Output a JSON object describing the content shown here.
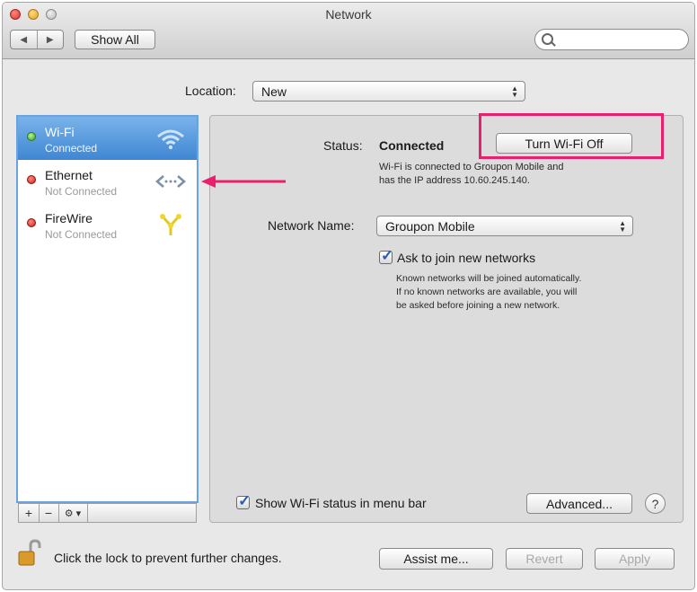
{
  "window": {
    "title": "Network"
  },
  "toolbar": {
    "back": "◀",
    "forward": "▶",
    "show_all": "Show All",
    "search_placeholder": ""
  },
  "location": {
    "label": "Location:",
    "value": "New"
  },
  "services": [
    {
      "name": "Wi-Fi",
      "status": "Connected",
      "dot": "#3a9d1d",
      "icon": "wifi-icon",
      "selected": true
    },
    {
      "name": "Ethernet",
      "status": "Not Connected",
      "dot": "#c81e16",
      "icon": "ethernet-arrows-icon",
      "selected": false
    },
    {
      "name": "FireWire",
      "status": "Not Connected",
      "dot": "#c81e16",
      "icon": "firewire-icon",
      "selected": false
    }
  ],
  "sidebar_tools": {
    "add": "+",
    "remove": "−",
    "gear": "⚙ ▾"
  },
  "detail": {
    "status_label": "Status:",
    "status_value": "Connected",
    "turn_off_button": "Turn Wi-Fi Off",
    "status_desc_1": "Wi-Fi is connected to Groupon Mobile and",
    "status_desc_2": "has the IP address 10.60.245.140.",
    "network_name_label": "Network Name:",
    "network_name_value": "Groupon Mobile",
    "ask_join_label": "Ask to join new networks",
    "ask_join_checked": true,
    "ask_join_desc_1": "Known networks will be joined automatically.",
    "ask_join_desc_2": "If no known networks are available, you will",
    "ask_join_desc_3": "be asked before joining a new network.",
    "show_status_label": "Show Wi-Fi status in menu bar",
    "show_status_checked": true,
    "advanced_button": "Advanced...",
    "help_button": "?"
  },
  "footer": {
    "lock_text": "Click the lock to prevent further changes.",
    "assist_button": "Assist me...",
    "revert_button": "Revert",
    "apply_button": "Apply"
  },
  "colors": {
    "highlight": "#ea1f6e",
    "selection": "#3f86d3",
    "arrow": "#ea1f6e"
  }
}
